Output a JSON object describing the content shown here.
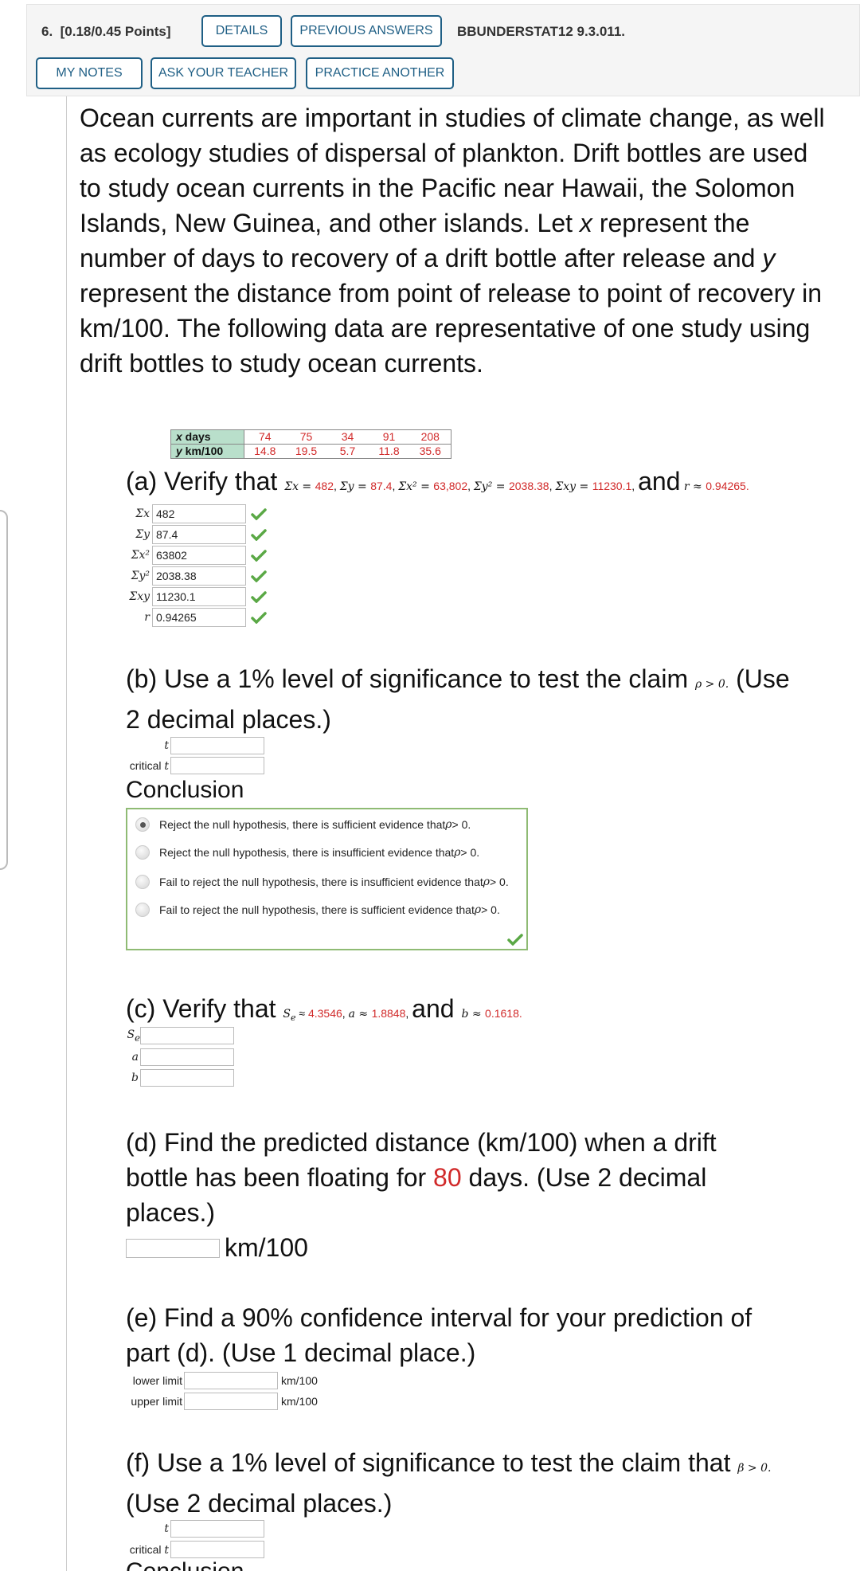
{
  "header": {
    "question_number": "6.",
    "points": "[0.18/0.45 Points]",
    "buttons": {
      "details": "DETAILS",
      "previous_answers": "PREVIOUS ANSWERS",
      "my_notes": "MY NOTES",
      "ask_teacher": "ASK YOUR TEACHER",
      "practice_another": "PRACTICE ANOTHER"
    },
    "problem_id": "BBUNDERSTAT12 9.3.011."
  },
  "intro": {
    "part1": "Ocean currents are important in studies of climate change, as well as ecology studies of dispersal of plankton. Drift bottles are used to study ocean currents in the Pacific near Hawaii, the Solomon Islands, New Guinea, and other islands. Let ",
    "var_x": "x",
    "part2": " represent the number of days to recovery of a drift bottle after release and ",
    "var_y": "y",
    "part3": " represent the distance from point of release to point of recovery in km/100. The following data are representative of one study using drift bottles to study ocean currents."
  },
  "data_table": {
    "row_x_label_var": "x",
    "row_x_label_rest": " days",
    "row_y_label_var": "y",
    "row_y_label_rest": " km/100",
    "x_values": [
      "74",
      "75",
      "34",
      "91",
      "208"
    ],
    "y_values": [
      "14.8",
      "19.5",
      "5.7",
      "11.8",
      "35.6"
    ]
  },
  "part_a": {
    "prefix": "(a) Verify that ",
    "claims": [
      {
        "lhs": "Σx = ",
        "rhs": "482",
        "sep": ", "
      },
      {
        "lhs": "Σy = ",
        "rhs": "87.4",
        "sep": ", "
      },
      {
        "lhs": "Σx² = ",
        "rhs": "63,802",
        "sep": ", "
      },
      {
        "lhs": "Σy² = ",
        "rhs": "2038.38",
        "sep": ", "
      },
      {
        "lhs": "Σxy = ",
        "rhs": "11230.1",
        "sep": ", "
      }
    ],
    "and": "and",
    "r_claim_lhs": "r ≈ ",
    "r_claim_rhs": "0.94265.",
    "fields": [
      {
        "label": "Σx",
        "value": "482",
        "status": "correct"
      },
      {
        "label": "Σy",
        "value": "87.4",
        "status": "correct"
      },
      {
        "label": "Σx²",
        "value": "63802",
        "status": "correct"
      },
      {
        "label": "Σy²",
        "value": "2038.38",
        "status": "correct"
      },
      {
        "label": "Σxy",
        "value": "11230.1",
        "status": "correct"
      },
      {
        "label": "r",
        "value": "0.94265",
        "status": "correct"
      }
    ]
  },
  "part_b": {
    "line1": "(b) Use a 1% level of significance to test the claim ",
    "claim": "ρ > 0.",
    "line1_end": " (Use",
    "line2": "2 decimal places.)",
    "t_label": "t",
    "t_value": "",
    "critical_label_text": "critical ",
    "critical_label_var": "t",
    "critical_value": "",
    "conclusion_title": "Conclusion",
    "options": [
      {
        "text": "Reject the null hypothesis, there is sufficient evidence that ",
        "selected": true
      },
      {
        "text": "Reject the null hypothesis, there is insufficient evidence that ",
        "selected": false
      },
      {
        "text": "Fail to reject the null hypothesis, there is insufficient evidence that ",
        "selected": false
      },
      {
        "text": "Fail to reject the null hypothesis, there is sufficient evidence that ",
        "selected": false
      }
    ],
    "option_suffix_var": "ρ",
    "option_suffix_rest": " > 0.",
    "conclusion_status": "correct"
  },
  "part_c": {
    "prefix": "(c) Verify that ",
    "se_lhs": "S",
    "se_sub": "e",
    "se_rhs": " ≈ ",
    "se_val": "4.3546",
    "a_lhs": "a ≈ ",
    "a_val": "1.8848",
    "and": "and",
    "b_lhs": "b ≈ ",
    "b_val": "0.1618.",
    "fields": [
      {
        "label": "S",
        "sub": "e",
        "value": ""
      },
      {
        "label": "a",
        "value": ""
      },
      {
        "label": "b",
        "value": ""
      }
    ]
  },
  "part_d": {
    "line1": "(d) Find the predicted distance (km/100) when a drift",
    "line2_a": "bottle has been floating for ",
    "days": "80",
    "line2_b": " days. (Use 2 decimal",
    "line3": "places.)",
    "value": "",
    "unit": "km/100"
  },
  "part_e": {
    "line1": "(e) Find a 90% confidence interval for your prediction of",
    "line2": "part (d). (Use 1 decimal place.)",
    "lower_label": "lower limit",
    "lower_value": "",
    "upper_label": "upper limit",
    "upper_value": "",
    "unit": "km/100"
  },
  "part_f": {
    "line1": "(f) Use a 1% level of significance to test the claim that ",
    "claim": "β > 0.",
    "line2": "(Use 2 decimal places.)",
    "t_label": "t",
    "t_value": "",
    "critical_label_text": "critical ",
    "critical_label_var": "t",
    "critical_value": "",
    "conclusion_partial": "Conclusion"
  },
  "colors": {
    "button_border": "#1f5f85",
    "highlight_red": "#d12a2a",
    "correct_green": "#5aa845",
    "table_header_bg": "#b9dfcb",
    "conclusion_border": "#8fbb74"
  }
}
